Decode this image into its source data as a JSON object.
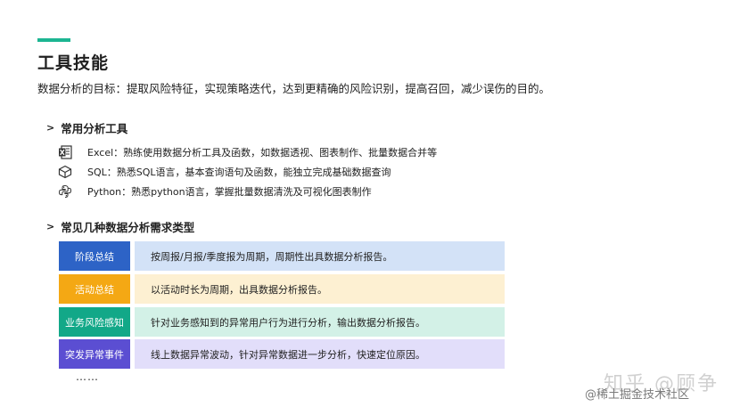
{
  "slide": {
    "title": "工具技能",
    "subtitle": "数据分析的目标：提取风险特征，实现策略迭代，达到更精确的风险识别，提高召回，减少误伤的目的。"
  },
  "tools_section": {
    "heading": "常用分析工具",
    "items": [
      {
        "icon": "excel-icon",
        "text": "Excel：熟练使用数据分析工具及函数，如数据透视、图表制作、批量数据合并等"
      },
      {
        "icon": "database-icon",
        "text": "SQL：熟悉SQL语言，基本查询语句及函数，能独立完成基础数据查询"
      },
      {
        "icon": "python-icon",
        "text": "Python：熟悉python语言，掌握批量数据清洗及可视化图表制作"
      }
    ]
  },
  "requirements_section": {
    "heading": "常见几种数据分析需求类型",
    "rows": [
      {
        "label": "阶段总结",
        "desc": "按周报/月报/季度报为周期，周期性出具数据分析报告。",
        "color": "#2d63c6"
      },
      {
        "label": "活动总结",
        "desc": "以活动时长为周期，出具数据分析报告。",
        "color": "#f4a814"
      },
      {
        "label": "业务风险感知",
        "desc": "针对业务感知到的异常用户行为进行分析，输出数据分析报告。",
        "color": "#12a888"
      },
      {
        "label": "突发异常事件",
        "desc": "线上数据异常波动，针对异常数据进一步分析，快速定位原因。",
        "color": "#5b4ed2"
      }
    ],
    "ellipsis": "……"
  },
  "watermark": {
    "big": "知乎 @顾争",
    "small": "@稀土掘金技术社区"
  },
  "colors": {
    "accent": "#1cb592"
  }
}
